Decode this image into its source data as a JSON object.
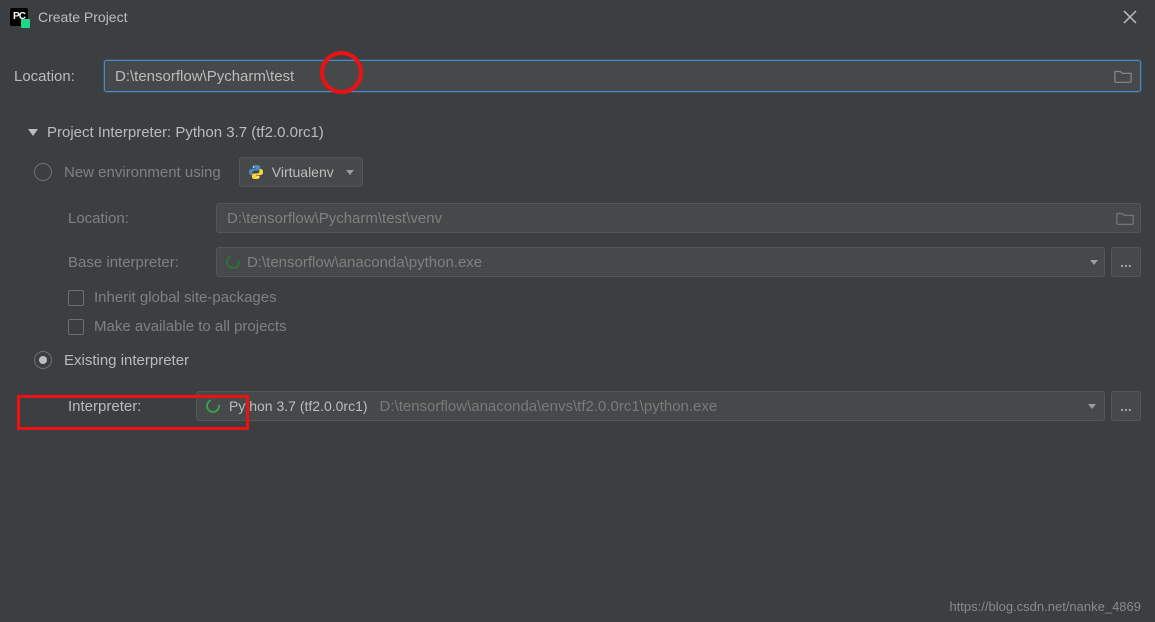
{
  "window": {
    "title": "Create Project",
    "app_icon_text": "PC"
  },
  "location": {
    "label": "Location:",
    "value": "D:\\tensorflow\\Pycharm\\test"
  },
  "section": {
    "title": "Project Interpreter: Python 3.7 (tf2.0.0rc1)"
  },
  "new_env": {
    "radio_label": "New environment using",
    "using": "Virtualenv",
    "location_label": "Location:",
    "location_value": "D:\\tensorflow\\Pycharm\\test\\venv",
    "base_label": "Base interpreter:",
    "base_value": "D:\\tensorflow\\anaconda\\python.exe",
    "inherit_label": "Inherit global site-packages",
    "make_avail_label": "Make available to all projects"
  },
  "existing": {
    "radio_label": "Existing interpreter",
    "interpreter_label": "Interpreter:",
    "selected_name": "Python 3.7 (tf2.0.0rc1)",
    "selected_path": "D:\\tensorflow\\anaconda\\envs\\tf2.0.0rc1\\python.exe"
  },
  "ellipsis": "...",
  "watermark": "https://blog.csdn.net/nanke_4869"
}
